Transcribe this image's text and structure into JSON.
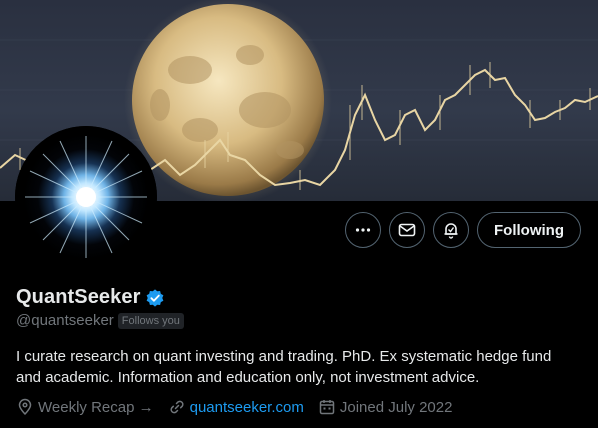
{
  "profile": {
    "name": "QuantSeeker",
    "handle": "@quantseeker",
    "follows_you": "Follows you",
    "bio": "I curate research on quant investing and trading. PhD. Ex systematic hedge fund and academic. Information and education only, not investment advice.",
    "location": "Weekly Recap →",
    "website": "quantseeker.com",
    "joined": "Joined July 2022"
  },
  "actions": {
    "following_label": "Following"
  },
  "icons": {
    "more": "more-dots-icon",
    "message": "envelope-icon",
    "notify": "bell-subscribed-icon",
    "verified": "verified-badge-icon",
    "location": "location-pin-icon",
    "link": "link-icon",
    "calendar": "calendar-icon"
  },
  "colors": {
    "background": "#000000",
    "accent": "#1d9bf0",
    "secondary_text": "#71767b",
    "border": "#536471"
  }
}
